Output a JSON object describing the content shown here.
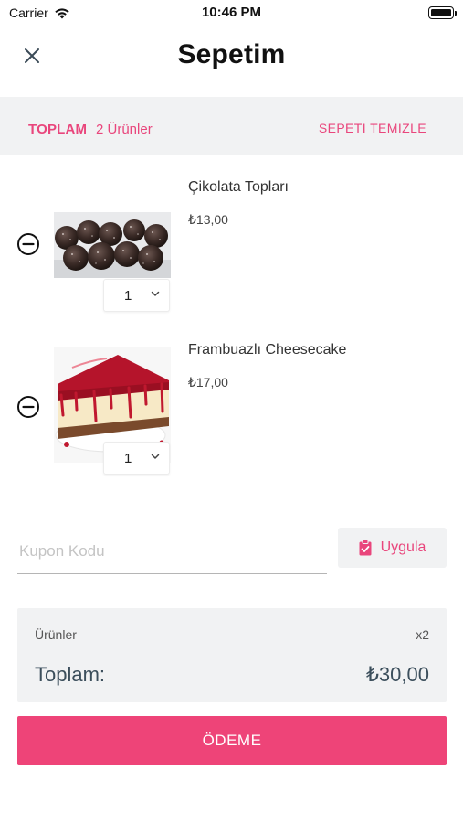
{
  "status_bar": {
    "carrier": "Carrier",
    "time": "10:46 PM"
  },
  "nav": {
    "title": "Sepetim"
  },
  "summary": {
    "label": "TOPLAM",
    "count": "2 Ürünler",
    "clear_label": "SEPETI TEMIZLE"
  },
  "items": [
    {
      "name": "Çikolata Topları",
      "price": "₺13,00",
      "quantity": "1"
    },
    {
      "name": "Frambuazlı Cheesecake",
      "price": "₺17,00",
      "quantity": "1"
    }
  ],
  "coupon": {
    "placeholder": "Kupon Kodu",
    "value": "",
    "apply_label": "Uygula"
  },
  "totals": {
    "products_label": "Ürünler",
    "products_count": "x2",
    "total_label": "Toplam:",
    "total_value": "₺30,00"
  },
  "checkout": {
    "label": "ÖDEME"
  },
  "colors": {
    "accent": "#e9467c",
    "pay_button": "#ee4478",
    "panel": "#f1f2f3",
    "total_text": "#3c4f5c"
  }
}
